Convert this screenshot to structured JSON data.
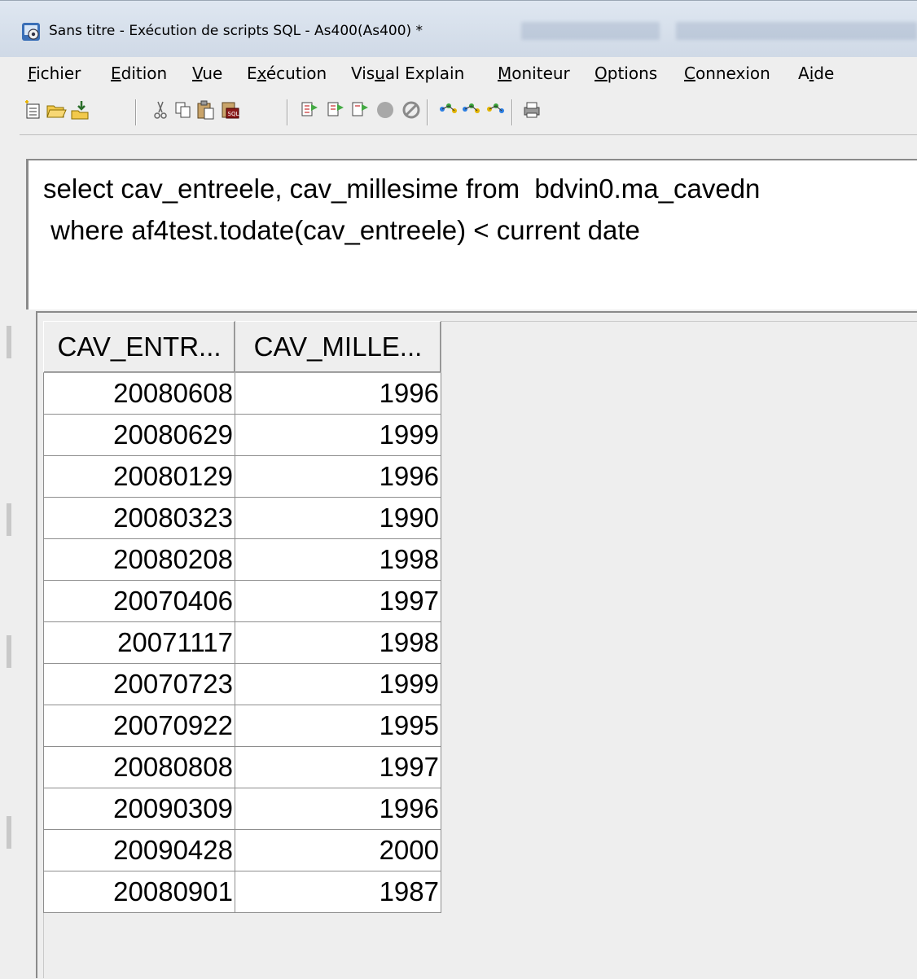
{
  "window": {
    "title": "Sans titre - Exécution de scripts SQL - As400(As400) *"
  },
  "menu": [
    {
      "label": "Fichier",
      "mnemonic": "F",
      "rest": "ichier"
    },
    {
      "label": "Edition",
      "mnemonic": "E",
      "rest": "dition"
    },
    {
      "label": "Vue",
      "mnemonic": "V",
      "rest": "ue"
    },
    {
      "label": "Exécution",
      "pre": "E",
      "mnemonic": "x",
      "rest": "écution"
    },
    {
      "label": "Visual Explain",
      "pre": "Vis",
      "mnemonic": "u",
      "rest": "al Explain"
    },
    {
      "label": "Moniteur",
      "mnemonic": "M",
      "rest": "oniteur"
    },
    {
      "label": "Options",
      "mnemonic": "O",
      "rest": "ptions"
    },
    {
      "label": "Connexion",
      "mnemonic": "C",
      "rest": "onnexion"
    },
    {
      "label": "Aide",
      "pre": "A",
      "mnemonic": "i",
      "rest": "de"
    }
  ],
  "toolbar": {
    "buttons": [
      "new-icon",
      "open-icon",
      "save-icon",
      "cut-icon",
      "copy-icon",
      "paste-icon",
      "insert-sql-icon",
      "run-all-icon",
      "run-from-selected-icon",
      "run-selected-icon",
      "stop-icon",
      "cancel-icon",
      "explain-icon",
      "run-and-explain-icon",
      "visual-explain-icon",
      "print-icon"
    ]
  },
  "editor": {
    "line1": "select cav_entreele, cav_millesime from  bdvin0.ma_cavedn",
    "line2": " where af4test.todate(cav_entreele) < current date"
  },
  "results": {
    "columns": [
      "CAV_ENTR...",
      "CAV_MILLE..."
    ],
    "rows": [
      [
        "20080608",
        "1996"
      ],
      [
        "20080629",
        "1999"
      ],
      [
        "20080129",
        "1996"
      ],
      [
        "20080323",
        "1990"
      ],
      [
        "20080208",
        "1998"
      ],
      [
        "20070406",
        "1997"
      ],
      [
        "20071117",
        "1998"
      ],
      [
        "20070723",
        "1999"
      ],
      [
        "20070922",
        "1995"
      ],
      [
        "20080808",
        "1997"
      ],
      [
        "20090309",
        "1996"
      ],
      [
        "20090428",
        "2000"
      ],
      [
        "20080901",
        "1987"
      ]
    ]
  }
}
